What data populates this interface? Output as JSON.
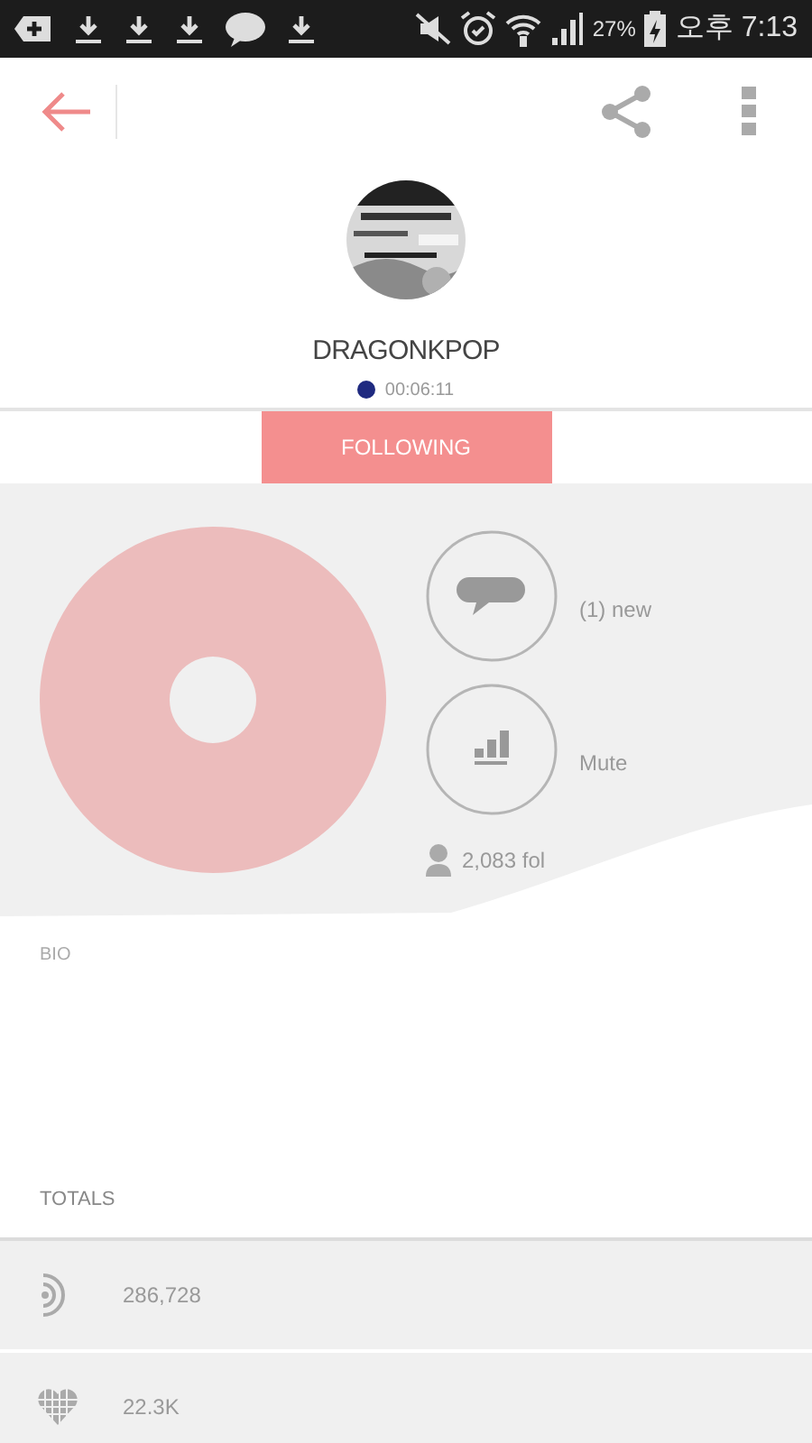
{
  "status_bar": {
    "battery": "27%",
    "time": "오후 7:13"
  },
  "profile": {
    "name": "DRAGONKPOP",
    "duration": "00:06:11"
  },
  "follow_button": {
    "label": "FOLLOWING"
  },
  "actions": [
    {
      "kind": "messages",
      "label": "(1) new"
    },
    {
      "kind": "mute",
      "label": "Mute"
    }
  ],
  "followers": "2,083 fol",
  "bio": {
    "heading": "BIO"
  },
  "totals": {
    "heading": "TOTALS",
    "rows": [
      {
        "kind": "plays",
        "value": "286,728"
      },
      {
        "kind": "likes",
        "value": "22.3K"
      }
    ]
  }
}
